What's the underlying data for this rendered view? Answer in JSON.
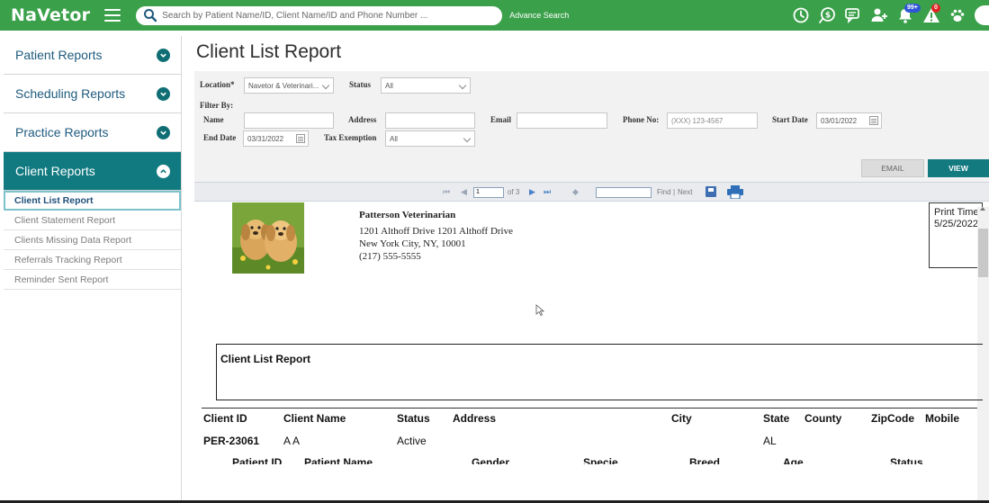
{
  "app": {
    "brand": "NaVetor",
    "search_placeholder": "Search by Patient Name/ID, Client Name/ID and Phone Number ...",
    "advance_search": "Advance Search",
    "notification_badge": "99+",
    "alert_badge": "0",
    "colors": {
      "brand_green": "#3aa14a",
      "teal": "#117a80",
      "link_blue": "#1f5b7e"
    }
  },
  "top_icons": [
    "clock-icon",
    "dollar-icon",
    "chat-icon",
    "add-user-icon",
    "bell-icon",
    "alert-icon",
    "paw-icon"
  ],
  "sidebar": {
    "sections": [
      {
        "label": "Patient Reports"
      },
      {
        "label": "Scheduling Reports"
      },
      {
        "label": "Practice Reports"
      },
      {
        "label": "Client Reports"
      }
    ],
    "client_items": [
      {
        "label": "Client List Report"
      },
      {
        "label": "Client Statement Report"
      },
      {
        "label": "Clients Missing Data Report"
      },
      {
        "label": "Referrals Tracking Report"
      },
      {
        "label": "Reminder Sent Report"
      }
    ]
  },
  "page": {
    "title": "Client List Report"
  },
  "filters": {
    "location_label": "Location*",
    "location_value": "Navetor & Veterinari...",
    "status_label": "Status",
    "status_value": "All",
    "filter_by_label": "Filter By:",
    "name_label": "Name",
    "address_label": "Address",
    "email_label": "Email",
    "phone_label": "Phone No:",
    "phone_placeholder": "(XXX) 123-4567",
    "start_date_label": "Start Date",
    "start_date_value": "03/01/2022",
    "end_date_label": "End Date",
    "end_date_value": "03/31/2022",
    "tax_label": "Tax Exemption",
    "tax_value": "All",
    "email_button": "EMAIL",
    "view_button": "VIEW"
  },
  "viewer": {
    "first_icon": "⏮",
    "prev_icon": "◀",
    "page_value": "1",
    "of_pages": "of 3",
    "next_icon": "▶",
    "last_icon": "⏭",
    "back_icon": "◆",
    "find_label": "Find",
    "sep": "|",
    "next_label": "Next"
  },
  "report": {
    "org_name": "Patterson Veterinarian",
    "address_line1": "1201 Althoff Drive 1201 Althoff Drive",
    "address_line2": "New York City, NY, 10001",
    "phone": "(217) 555-5555",
    "print_time_label": "Print Time",
    "print_time_value": "5/25/2022",
    "title": "Client List Report",
    "columns": [
      "Client ID",
      "Client Name",
      "Status",
      "Address",
      "City",
      "State",
      "County",
      "ZipCode",
      "Mobile"
    ],
    "rows": [
      {
        "client_id": "PER-23061",
        "client_name": "A A",
        "status": "Active",
        "state": "AL"
      }
    ],
    "patient_columns": [
      "Patient ID",
      "Patient Name",
      "Gender",
      "Specie",
      "Breed",
      "Age",
      "Status"
    ]
  }
}
